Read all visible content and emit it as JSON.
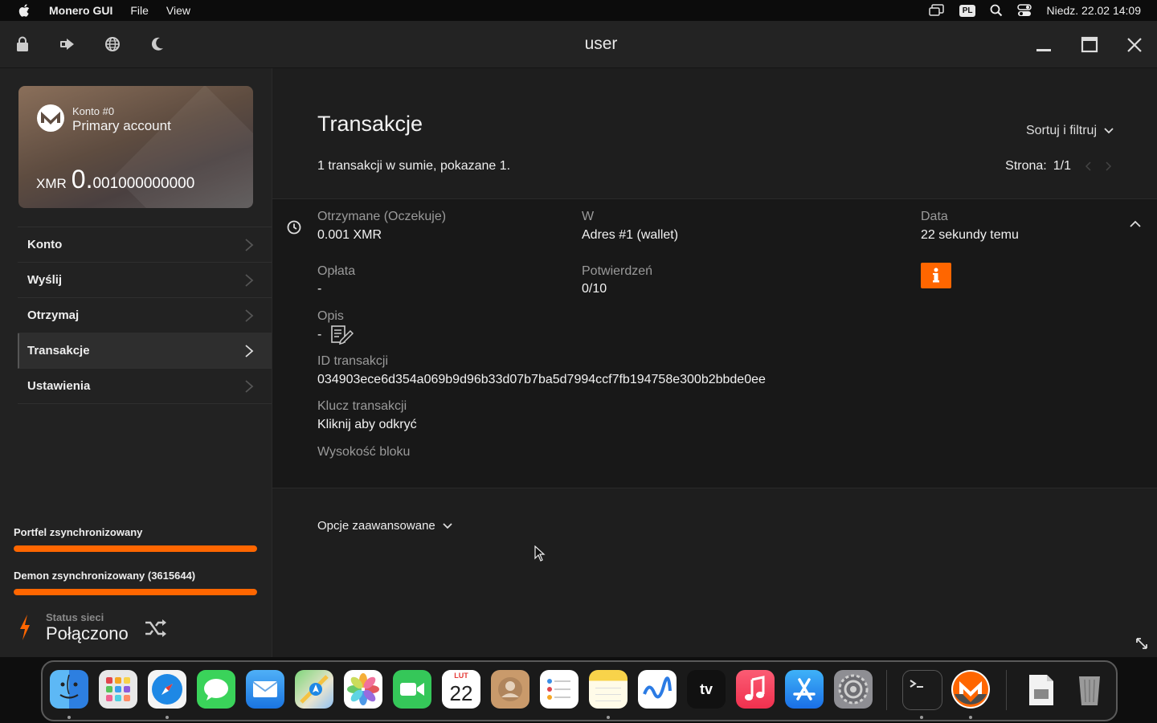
{
  "menubar": {
    "app_name": "Monero GUI",
    "items": [
      "File",
      "View"
    ],
    "input_source": "PL",
    "datetime": "Niedz. 22.02  14:09"
  },
  "titlebar": {
    "title": "user"
  },
  "account": {
    "number": "Konto #0",
    "name": "Primary account",
    "currency": "XMR",
    "balance_int": "0.",
    "balance_dec": "001000000000"
  },
  "sidebar": {
    "items": [
      {
        "label": "Konto",
        "active": false
      },
      {
        "label": "Wyślij",
        "active": false
      },
      {
        "label": "Otrzymaj",
        "active": false
      },
      {
        "label": "Transakcje",
        "active": true
      },
      {
        "label": "Ustawienia",
        "active": false
      }
    ],
    "wallet_sync": {
      "label": "Portfel zsynchronizowany",
      "progress": 1.0
    },
    "daemon_sync": {
      "label": "Demon zsynchronizowany (3615644)",
      "progress": 1.0
    },
    "network": {
      "label": "Status sieci",
      "value": "Połączono"
    }
  },
  "main": {
    "title": "Transakcje",
    "summary": "1 transakcji w sumie, pokazane 1.",
    "sort_filter": "Sortuj i filtruj",
    "page_label": "Strona:",
    "page_value": "1/1",
    "transaction": {
      "received_label": "Otrzymane (Oczekuje)",
      "received_value": "0.001 XMR",
      "in_label": "W",
      "in_value": "Adres #1 (wallet)",
      "date_label": "Data",
      "date_value": "22 sekundy temu",
      "fee_label": "Opłata",
      "fee_value": "-",
      "confirmations_label": "Potwierdzeń",
      "confirmations_value": "0/10",
      "description_label": "Opis",
      "description_value": "-",
      "txid_label": "ID transakcji",
      "txid_value": "034903ece6d354a069b9d96b33d07b7ba5d7994ccf7fb194758e300b2bbde0ee",
      "txkey_label": "Klucz transakcji",
      "txkey_value": "Kliknij aby odkryć",
      "block_height_label": "Wysokość bloku"
    },
    "advanced_options": "Opcje zaawansowane"
  },
  "colors": {
    "accent": "#ff6600",
    "background": "#1c1c1c"
  },
  "dock": {
    "apps": [
      "finder",
      "launchpad",
      "safari",
      "messages",
      "mail",
      "maps",
      "photos",
      "facetime",
      "calendar",
      "contacts",
      "reminders",
      "notes",
      "freeform",
      "tv",
      "music",
      "app-store",
      "system-settings",
      "terminal",
      "monero",
      "preview",
      "trash"
    ],
    "calendar_month": "LUT",
    "calendar_day": "22",
    "tv_label": "tv"
  }
}
